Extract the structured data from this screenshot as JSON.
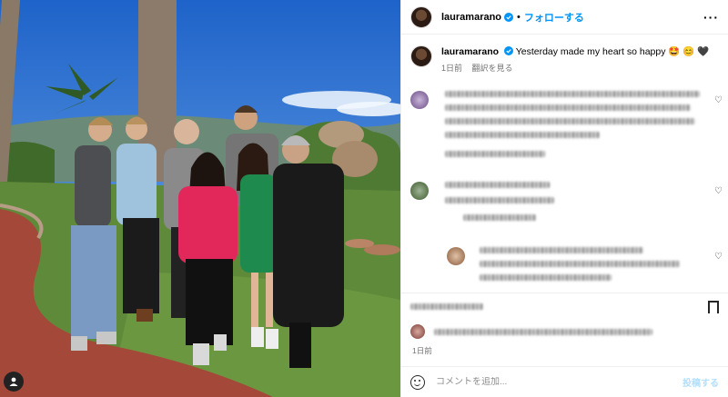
{
  "header": {
    "username": "lauramarano",
    "dot": "•",
    "follow_label": "フォローする",
    "more_label": "···"
  },
  "caption": {
    "username": "lauramarano",
    "text": "Yesterday made my heart so happy 🤩 😊 🖤",
    "time": "1日前",
    "translate": "翻訳を見る"
  },
  "footer": {
    "time": "1日前"
  },
  "compose": {
    "placeholder": "コメントを追加...",
    "post_label": "投稿する"
  },
  "colors": {
    "accent": "#0095f6",
    "sky": "#3f7fd0",
    "grass": "#5f8a3a",
    "path": "#a4483a"
  },
  "icons": {
    "verified": "verified-badge-icon",
    "heart": "heart-icon",
    "bookmark": "bookmark-icon",
    "emoji": "emoji-icon",
    "tag": "person-tag-icon"
  }
}
